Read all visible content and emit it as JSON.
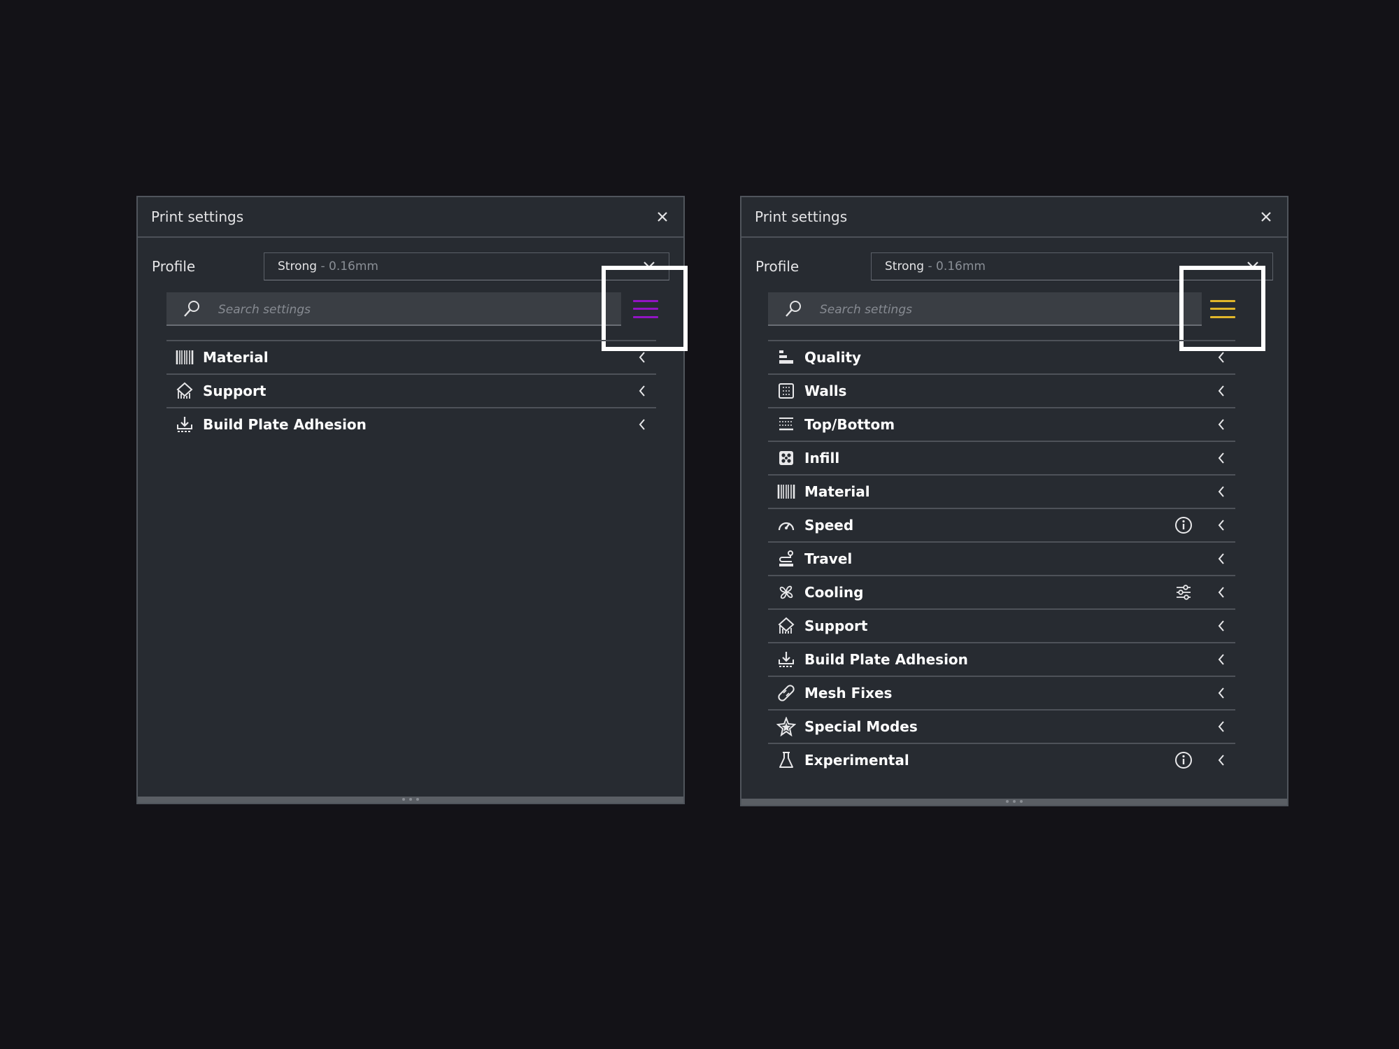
{
  "colors": {
    "menu_left": "#9214c4",
    "menu_right": "#e0b62a",
    "highlight": "#ffffff",
    "panel_bg": "#272b31",
    "page_bg": "#131217"
  },
  "left_panel": {
    "title": "Print settings",
    "profile_label": "Profile",
    "profile_name": "Strong",
    "profile_sep": " - ",
    "profile_layer": "0.16mm",
    "search_placeholder": "Search settings",
    "categories": [
      {
        "label": "Material",
        "icon": "material-icon"
      },
      {
        "label": "Support",
        "icon": "support-icon"
      },
      {
        "label": "Build Plate Adhesion",
        "icon": "adhesion-icon"
      }
    ]
  },
  "right_panel": {
    "title": "Print settings",
    "profile_label": "Profile",
    "profile_name": "Strong",
    "profile_sep": " - ",
    "profile_layer": "0.16mm",
    "search_placeholder": "Search settings",
    "categories": [
      {
        "label": "Quality",
        "icon": "quality-icon"
      },
      {
        "label": "Walls",
        "icon": "walls-icon"
      },
      {
        "label": "Top/Bottom",
        "icon": "top-bottom-icon"
      },
      {
        "label": "Infill",
        "icon": "infill-icon"
      },
      {
        "label": "Material",
        "icon": "material-icon"
      },
      {
        "label": "Speed",
        "icon": "speed-icon",
        "extra": "info-icon"
      },
      {
        "label": "Travel",
        "icon": "travel-icon"
      },
      {
        "label": "Cooling",
        "icon": "cooling-icon",
        "extra": "sliders-icon"
      },
      {
        "label": "Support",
        "icon": "support-icon"
      },
      {
        "label": "Build Plate Adhesion",
        "icon": "adhesion-icon"
      },
      {
        "label": "Mesh Fixes",
        "icon": "mesh-fixes-icon"
      },
      {
        "label": "Special Modes",
        "icon": "special-modes-icon"
      },
      {
        "label": "Experimental",
        "icon": "experimental-icon",
        "extra": "info-icon"
      }
    ]
  }
}
